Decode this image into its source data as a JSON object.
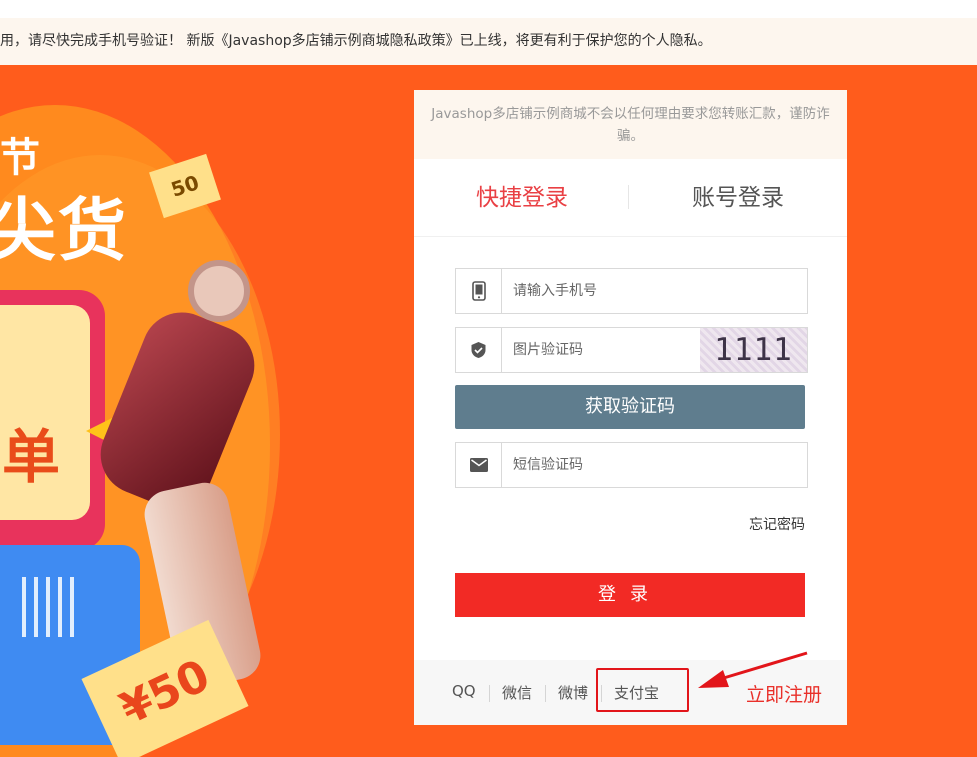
{
  "notice": {
    "prefix": "用，请尽快完成手机号验证！ 新版《",
    "link": "Javashop多店铺示例商城隐私政策",
    "suffix": "》已上线，将更有利于保护您的个人隐私。"
  },
  "banner": {
    "promo_top": "节",
    "promo_big": "尖货",
    "card_char": "单",
    "ticket_small": "50",
    "ticket_big": "¥50"
  },
  "login": {
    "security_notice": "Javashop多店铺示例商城不会以任何理由要求您转账汇款，谨防诈骗。",
    "tabs": [
      {
        "label": "快捷登录",
        "active": true
      },
      {
        "label": "账号登录",
        "active": false
      }
    ],
    "phone_placeholder": "请输入手机号",
    "image_code_placeholder": "图片验证码",
    "captcha_text": "1111",
    "get_code_button": "获取验证码",
    "sms_code_placeholder": "短信验证码",
    "forgot_password": "忘记密码",
    "login_button": "登录",
    "social": [
      "QQ",
      "微信",
      "微博",
      "支付宝"
    ],
    "register": "立即注册"
  },
  "colors": {
    "accent_red": "#f22a25",
    "tab_active": "#e94044",
    "code_button": "#5f7d8e",
    "banner_bg": "#ff5c1c",
    "annotation": "#e2151a"
  },
  "icons": [
    "phone-icon",
    "shield-icon",
    "envelope-icon",
    "arrow-icon"
  ]
}
